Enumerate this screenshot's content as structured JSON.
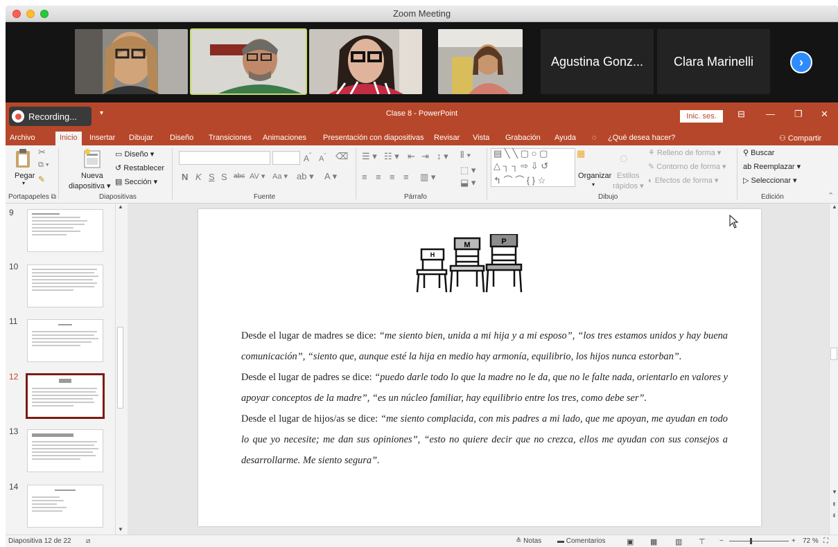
{
  "window": {
    "title": "Zoom Meeting"
  },
  "participants": {
    "names": [
      "Agustina Gonz...",
      "Clara Marinelli"
    ],
    "video_tiles": [
      "participant-1",
      "participant-2-active",
      "participant-3",
      "participant-4"
    ],
    "next_icon": "chevron-right-icon"
  },
  "recording": {
    "label": "Recording..."
  },
  "app": {
    "title": "Clase 8  -  PowerPoint",
    "signin": "Inic. ses."
  },
  "tabs": [
    "Archivo",
    "Inicio",
    "Insertar",
    "Dibujar",
    "Diseño",
    "Transiciones",
    "Animaciones",
    "Presentación con diapositivas",
    "Revisar",
    "Vista",
    "Grabación",
    "Ayuda"
  ],
  "tell_me": "¿Qué desea hacer?",
  "share": "Compartir",
  "ribbon": {
    "clipboard": {
      "paste": "Pegar",
      "group": "Portapapeles"
    },
    "slides": {
      "new_1": "Nueva",
      "new_2": "diapositiva",
      "layout": "Diseño",
      "reset": "Restablecer",
      "section": "Sección",
      "group": "Diapositivas"
    },
    "font": {
      "group": "Fuente",
      "bold": "N",
      "italic": "K",
      "underline": "S",
      "shadow": "S",
      "strike": "abc",
      "spacing": "AV",
      "case": "Aa",
      "grow": "A",
      "shrink": "A"
    },
    "paragraph": {
      "group": "Párrafo"
    },
    "drawing": {
      "arrange": "Organizar",
      "styles_1": "Estilos",
      "styles_2": "rápidos",
      "fill": "Relleno de forma",
      "outline": "Contorno de forma",
      "effects": "Efectos de forma",
      "group": "Dibujo"
    },
    "editing": {
      "find": "Buscar",
      "replace": "Reemplazar",
      "select": "Seleccionar",
      "group": "Edición"
    }
  },
  "thumbnails": [
    {
      "num": "9"
    },
    {
      "num": "10"
    },
    {
      "num": "11"
    },
    {
      "num": "12"
    },
    {
      "num": "13"
    },
    {
      "num": "14"
    }
  ],
  "slide": {
    "chair_labels": [
      "H",
      "M",
      "P"
    ],
    "p1_lead": "Desde el lugar de madres se dice: ",
    "p1_quote": "“me siento bien, unida a mi hija y a mi esposo”, “los tres estamos unidos y hay buena comunicación”, “siento que, aunque esté la hija en medio hay armonía, equilibrio, los hijos nunca estorban”.",
    "p2_lead": "Desde el lugar de padres se dice: ",
    "p2_quote": "“puedo darle todo lo que la madre no le da, que no le falte nada, orientarlo en valores y apoyar conceptos de la madre”, “es un núcleo familiar, hay equilibrio entre los tres, como debe ser”.",
    "p3_lead": "Desde el lugar de hijos/as se dice: ",
    "p3_quote": "“me siento complacida, con mis padres a mi lado, que me apoyan, me ayudan en todo lo que yo necesite; me dan sus opiniones”, “esto no quiere decir que no crezca, ellos me ayudan con sus consejos a desarrollarme. Me siento segura”."
  },
  "status": {
    "slide_counter": "Diapositiva 12 de 22",
    "notes": "Notas",
    "comments": "Comentarios",
    "zoom": "72 %",
    "zoom_level": 0.72
  },
  "colors": {
    "powerpoint_brand": "#b7472a",
    "zoom_blue": "#2d8cff",
    "active_speaker": "#c6dd6b",
    "selected_thumb": "#7a1c12"
  }
}
